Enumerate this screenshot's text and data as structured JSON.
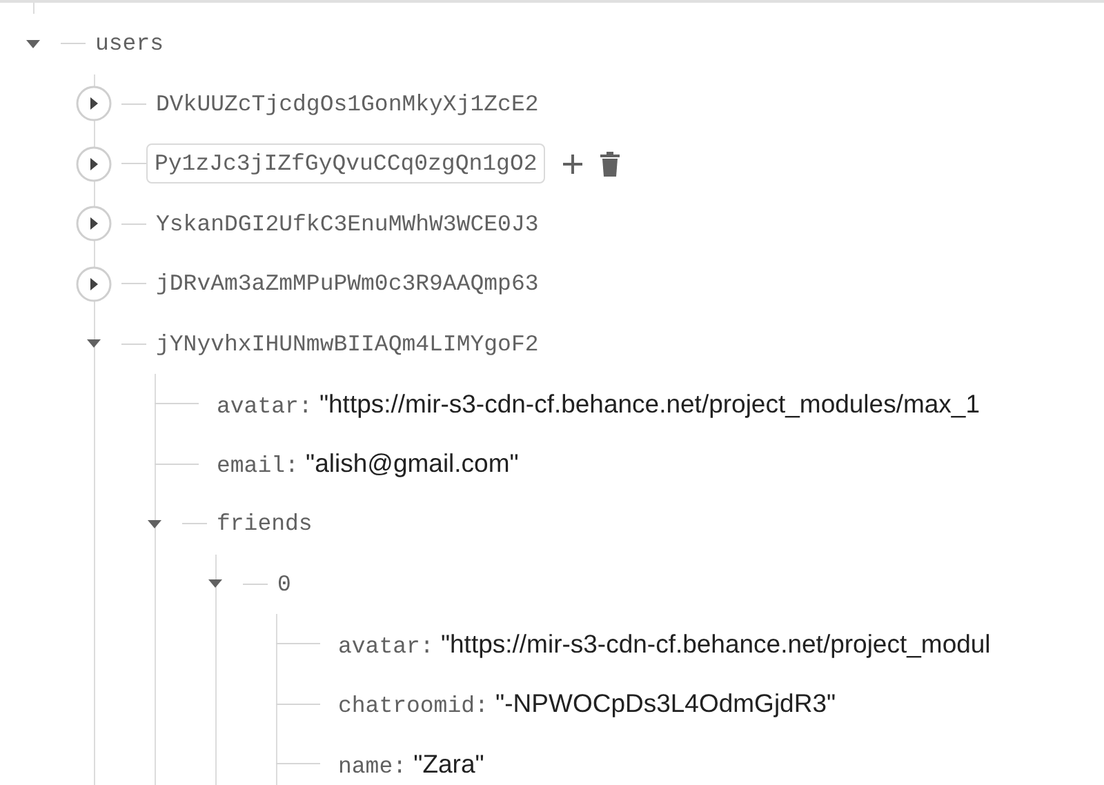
{
  "tree": [
    {
      "key": "users",
      "kind": "branch",
      "expanded": true,
      "selected": false,
      "children": [
        {
          "key": "DVkUUZcTjcdgOs1GonMkyXj1ZcE2",
          "kind": "branch",
          "expanded": false,
          "selected": false
        },
        {
          "key": "Py1zJc3jIZfGyQvuCCq0zgQn1gO2",
          "kind": "branch",
          "expanded": false,
          "selected": true
        },
        {
          "key": "YskanDGI2UfkC3EnuMWhW3WCE0J3",
          "kind": "branch",
          "expanded": false,
          "selected": false
        },
        {
          "key": "jDRvAm3aZmMPuPWm0c3R9AAQmp63",
          "kind": "branch",
          "expanded": false,
          "selected": false
        },
        {
          "key": "jYNyvhxIHUNmwBIIAQm4LIMYgoF2",
          "kind": "branch",
          "expanded": true,
          "selected": false,
          "children": [
            {
              "key": "avatar:",
              "kind": "leaf",
              "value": "\"https://mir-s3-cdn-cf.behance.net/project_modules/max_1",
              "selected": false
            },
            {
              "key": "email:",
              "kind": "leaf",
              "value": "\"alish@gmail.com\"",
              "selected": false
            },
            {
              "key": "friends",
              "kind": "branch",
              "expanded": true,
              "selected": false,
              "children": [
                {
                  "key": "0",
                  "kind": "branch",
                  "expanded": true,
                  "selected": false,
                  "children": [
                    {
                      "key": "avatar:",
                      "kind": "leaf",
                      "value": "\"https://mir-s3-cdn-cf.behance.net/project_modul",
                      "selected": false
                    },
                    {
                      "key": "chatroomid:",
                      "kind": "leaf",
                      "value": "\"-NPWOCpDs3L4OdmGjdR3\"",
                      "selected": false
                    },
                    {
                      "key": "name:",
                      "kind": "leaf",
                      "value": "\"Zara\"",
                      "selected": false
                    }
                  ]
                }
              ]
            }
          ]
        }
      ]
    }
  ]
}
